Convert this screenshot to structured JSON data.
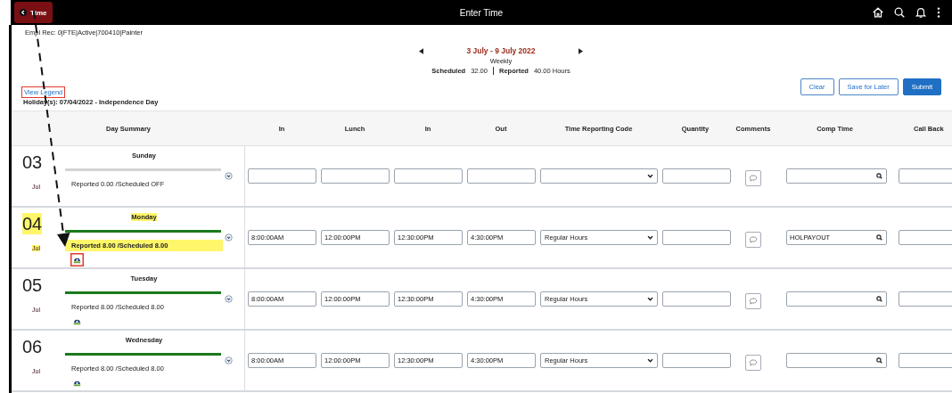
{
  "top_bar": {
    "back_button": "Time",
    "title": "Enter Time"
  },
  "employee_record": "Empl Rec: 0|FTE|Active|700410|Painter",
  "period": {
    "label": "3 July - 9 July 2022",
    "view": "Weekly",
    "scheduled_label": "Scheduled",
    "scheduled": "32.00",
    "reported_label": "Reported",
    "reported": "40.00 Hours"
  },
  "view_legend": {
    "label": "View Legend",
    "highlighted": true
  },
  "holiday": "Holiday(s): 07/04/2022 - Independence Day",
  "buttons": [
    {
      "label": "Clear",
      "kind": "secondary"
    },
    {
      "label": "Save for Later",
      "kind": "secondary"
    },
    {
      "label": "Submit",
      "kind": "primary"
    }
  ],
  "columns": [
    "Day Summary",
    "In",
    "Lunch",
    "In",
    "Out",
    "Time Reporting Code",
    "Quantity",
    "Comments",
    "Comp Time",
    "Call Back"
  ],
  "days": [
    {
      "date": "03",
      "month": "Jul",
      "weekday": "Sunday",
      "summary": "Reported 0.00 /Scheduled OFF",
      "holiday": false,
      "on_schedule": false,
      "icon": false
    },
    {
      "date": "04",
      "month": "Jul",
      "weekday": "Monday",
      "summary": "Reported 8.00 /Scheduled 8.00",
      "holiday": true,
      "on_schedule": true,
      "icon": true,
      "icon_highlighted": true,
      "in": "8:00:00AM",
      "lunch": "12:00:00PM",
      "in_2": "12:30:00PM",
      "out": "4:30:00PM",
      "code": "Regular Hours",
      "comp_time": "HOLPAYOUT"
    },
    {
      "date": "05",
      "month": "Jul",
      "weekday": "Tuesday",
      "summary": "Reported 8.00 /Scheduled 8.00",
      "holiday": false,
      "on_schedule": true,
      "icon": true,
      "icon_highlighted": false,
      "in": "8:00:00AM",
      "lunch": "12:00:00PM",
      "in_2": "12:30:00PM",
      "out": "4:30:00PM",
      "code": "Regular Hours"
    },
    {
      "date": "06",
      "month": "Jul",
      "weekday": "Wednesday",
      "summary": "Reported 8.00 /Scheduled 8.00",
      "holiday": false,
      "on_schedule": true,
      "icon": true,
      "icon_highlighted": false,
      "in": "8:00:00AM",
      "lunch": "12:00:00PM",
      "in_2": "12:30:00PM",
      "out": "4:30:00PM",
      "code": "Regular Hours"
    }
  ]
}
